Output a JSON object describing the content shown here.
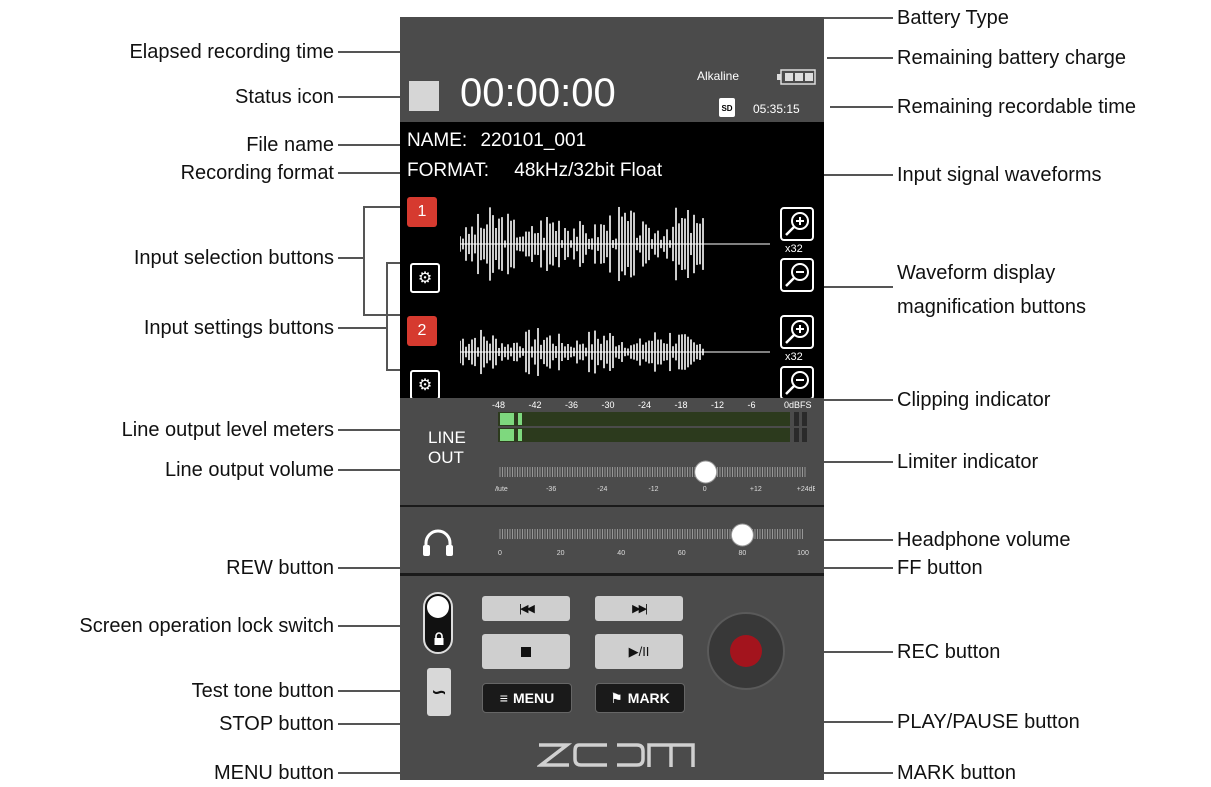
{
  "device": {
    "elapsed_time": "00:00:00",
    "battery_type": "Alkaline",
    "remaining_time": "05:35:15",
    "sd_label": "SD",
    "file_name_label": "NAME:",
    "file_name": "220101_001",
    "format_label": "FORMAT:",
    "format": "48kHz/32bit Float",
    "ch1": "1",
    "ch2": "2",
    "zoom_level_1": "x32",
    "zoom_level_2": "x32",
    "meter_scale": [
      "-48",
      "-42",
      "-36",
      "-30",
      "-24",
      "-18",
      "-12",
      "-6",
      "0dBFS"
    ],
    "line_out_label_1": "LINE",
    "line_out_label_2": "OUT",
    "lineout_scale": [
      "Mute",
      "-36",
      "-24",
      "-12",
      "0",
      "+12",
      "+24dB"
    ],
    "lineout_volume": 0.67,
    "headphone_scale": [
      "0",
      "20",
      "40",
      "60",
      "80",
      "100"
    ],
    "headphone_volume": 0.8,
    "menu_label": "MENU",
    "mark_label": "MARK",
    "brand": "ZOOM",
    "accent_red": "#d63a2f",
    "rec_color": "#a3141d"
  },
  "annotations": {
    "elapsed": "Elapsed recording time",
    "status_icon": "Status icon",
    "file_name": "File name",
    "recording_format": "Recording format",
    "input_selection": "Input selection buttons",
    "input_settings": "Input settings buttons",
    "line_meters": "Line output level meters",
    "line_volume": "Line output volume",
    "rew": "REW button",
    "lock": "Screen operation lock switch",
    "test_tone": "Test tone button",
    "stop": "STOP button",
    "menu": "MENU button",
    "battery_type": "Battery Type",
    "battery_charge": "Remaining battery charge",
    "rec_time": "Remaining recordable time",
    "waveforms": "Input signal waveforms",
    "magnification_1": "Waveform display",
    "magnification_2": "magnification buttons",
    "clipping": "Clipping indicator",
    "limiter": "Limiter indicator",
    "headphone": "Headphone volume",
    "ff": "FF button",
    "rec": "REC button",
    "play_pause": "PLAY/PAUSE button",
    "mark": "MARK button"
  }
}
